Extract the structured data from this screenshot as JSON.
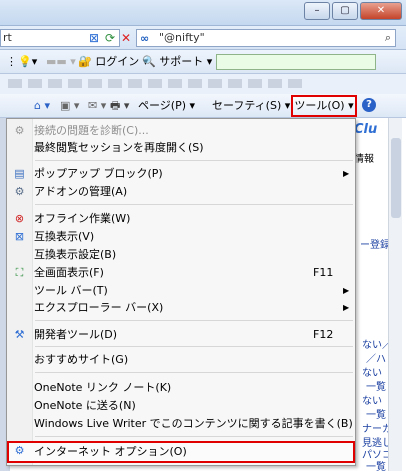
{
  "window": {
    "minimize_glyph": "–",
    "restore_glyph": "▢",
    "close_glyph": "✕"
  },
  "address": {
    "partial_text": "rt"
  },
  "search": {
    "provider": "\"@nifty\"",
    "go_glyph": "⌕"
  },
  "toolbar": {
    "login_label": "ログイン",
    "support_label": "サポート"
  },
  "command_bar": {
    "page_label": "ページ(P)",
    "safety_label": "セーフティ(S)",
    "tools_label": "ツール(O)",
    "help_glyph": "?"
  },
  "background_page": {
    "logo": "Clu",
    "info": "情報",
    "register": "ー登録",
    "line1": "ない／",
    "line2": "／ハ",
    "line3": "ない",
    "line4": "一覧",
    "line5": "ない",
    "line6": "一覧",
    "line7": "ナーガ",
    "line8": "見逃し",
    "line9": "パソコ",
    "line10": "一覧"
  },
  "menu": {
    "items": [
      {
        "label": "接続の問題を診断(C)...",
        "shortcut": "",
        "submenu": false,
        "disabled": true,
        "icon": "diagnose-icon"
      },
      {
        "label": "最終閲覧セッションを再度開く(S)",
        "shortcut": "",
        "submenu": false,
        "disabled": false,
        "icon": ""
      },
      {
        "label": "ポップアップ ブロック(P)",
        "shortcut": "",
        "submenu": true,
        "disabled": false,
        "icon": "popup-blocker-icon"
      },
      {
        "label": "アドオンの管理(A)",
        "shortcut": "",
        "submenu": false,
        "disabled": false,
        "icon": "addon-icon"
      },
      {
        "label": "オフライン作業(W)",
        "shortcut": "",
        "submenu": false,
        "disabled": false,
        "icon": "offline-icon"
      },
      {
        "label": "互換表示(V)",
        "shortcut": "",
        "submenu": false,
        "disabled": false,
        "icon": "compat-view-icon"
      },
      {
        "label": "互換表示設定(B)",
        "shortcut": "",
        "submenu": false,
        "disabled": false,
        "icon": ""
      },
      {
        "label": "全画面表示(F)",
        "shortcut": "F11",
        "submenu": false,
        "disabled": false,
        "icon": "fullscreen-icon"
      },
      {
        "label": "ツール バー(T)",
        "shortcut": "",
        "submenu": true,
        "disabled": false,
        "icon": ""
      },
      {
        "label": "エクスプローラー バー(X)",
        "shortcut": "",
        "submenu": true,
        "disabled": false,
        "icon": ""
      },
      {
        "label": "開発者ツール(D)",
        "shortcut": "F12",
        "submenu": false,
        "disabled": false,
        "icon": "developer-tools-icon"
      },
      {
        "label": "おすすめサイト(G)",
        "shortcut": "",
        "submenu": false,
        "disabled": false,
        "icon": ""
      },
      {
        "label": "OneNote リンク ノート(K)",
        "shortcut": "",
        "submenu": false,
        "disabled": false,
        "icon": ""
      },
      {
        "label": "OneNote に送る(N)",
        "shortcut": "",
        "submenu": false,
        "disabled": false,
        "icon": ""
      },
      {
        "label": "Windows Live Writer でこのコンテンツに関する記事を書く(B)",
        "shortcut": "",
        "submenu": false,
        "disabled": false,
        "icon": ""
      },
      {
        "label": "インターネット オプション(O)",
        "shortcut": "",
        "submenu": false,
        "disabled": false,
        "icon": "internet-options-icon"
      }
    ]
  }
}
